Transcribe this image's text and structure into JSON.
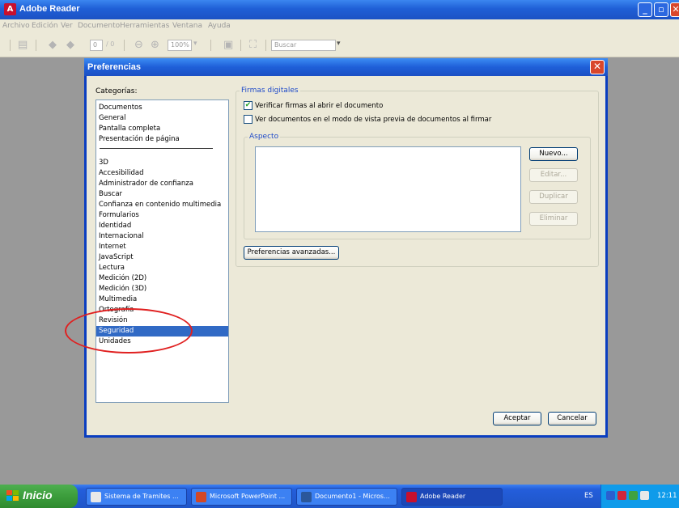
{
  "window": {
    "title": "Adobe Reader",
    "controls": {
      "minimize": "_",
      "maximize": "▫",
      "close": "✕"
    }
  },
  "menu": [
    "Archivo",
    "Edición",
    "Ver",
    "Documento",
    "Herramientas",
    "Ventana",
    "Ayuda"
  ],
  "toolbar": {
    "page_current": "0",
    "page_total": "/ 0",
    "zoom": "100%",
    "search_placeholder": "Buscar"
  },
  "dialog": {
    "title": "Preferencias",
    "categories_label": "Categorías:",
    "categories_top": [
      "Documentos",
      "General",
      "Pantalla completa",
      "Presentación de página"
    ],
    "categories_bottom": [
      "3D",
      "Accesibilidad",
      "Administrador de confianza",
      "Buscar",
      "Confianza en contenido multimedia",
      "Formularios",
      "Identidad",
      "Internacional",
      "Internet",
      "JavaScript",
      "Lectura",
      "Medición (2D)",
      "Medición (3D)",
      "Multimedia",
      "Ortografía",
      "Revisión",
      "Seguridad",
      "Unidades"
    ],
    "selected_category": "Seguridad",
    "firmas": {
      "legend": "Firmas digitales",
      "check1_label": "Verificar firmas al abrir el documento",
      "check1_checked": true,
      "check2_label": "Ver documentos en el modo de vista previa de documentos al firmar",
      "check2_checked": false,
      "aspecto_legend": "Aspecto",
      "btn_nuevo": "Nuevo...",
      "btn_editar": "Editar...",
      "btn_duplicar": "Duplicar",
      "btn_eliminar": "Eliminar"
    },
    "btn_avanzadas": "Preferencias avanzadas...",
    "btn_aceptar": "Aceptar",
    "btn_cancelar": "Cancelar"
  },
  "taskbar": {
    "start": "Inicio",
    "tasks": [
      "Sistema de Tramites ...",
      "Microsoft PowerPoint ...",
      "Documento1 - Micros...",
      "Adobe Reader"
    ],
    "language": "ES",
    "clock": "12:11"
  },
  "colors": {
    "accent": "#316ac5",
    "titlebar": "#1f5fd6",
    "annotation": "#e02020"
  }
}
